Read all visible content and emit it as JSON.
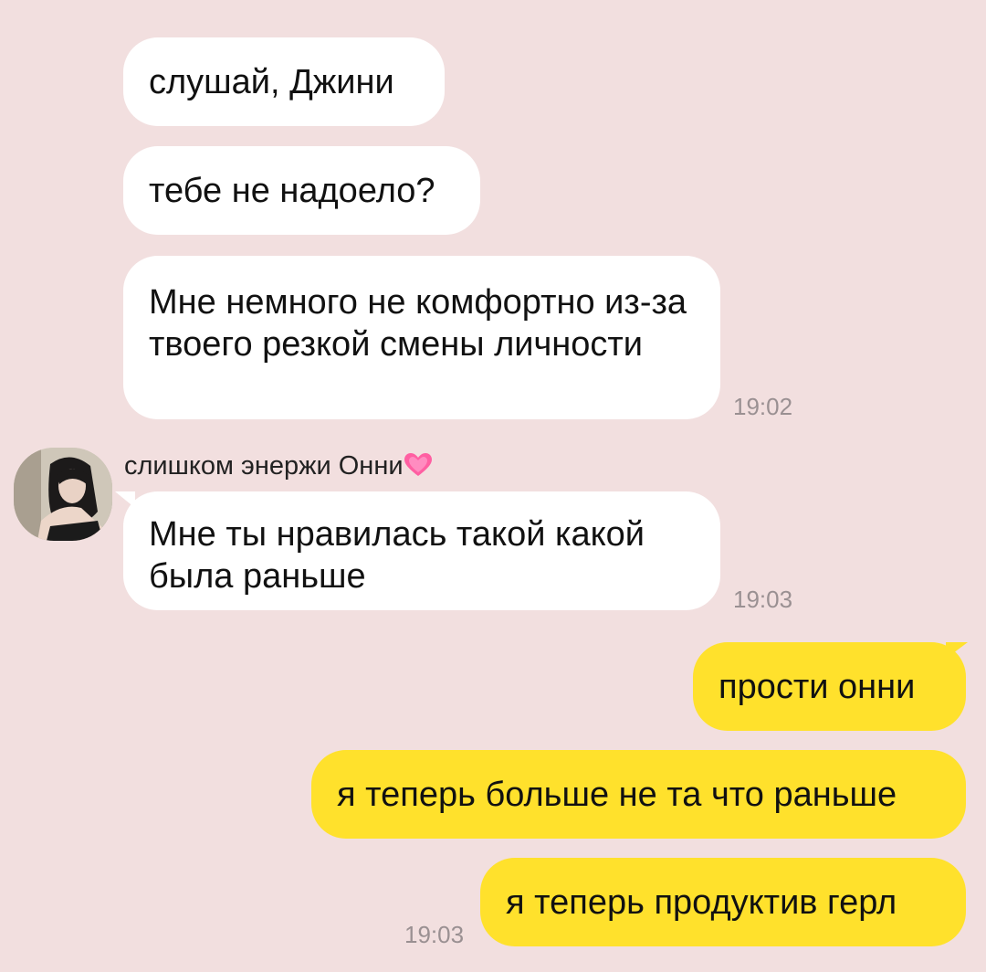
{
  "chat": {
    "incoming": [
      {
        "text": "слушай, Джини"
      },
      {
        "text": "тебе не надоело?"
      },
      {
        "text": "Мне немного не комфортно из-за твоего резкой смены личности",
        "time": "19:02"
      },
      {
        "text": "Мне ты нравилась такой какой была раньше",
        "time": "19:03"
      }
    ],
    "sender": {
      "name": "слишком энержи Онни",
      "emoji": "💓"
    },
    "outgoing": [
      {
        "text": "прости онни"
      },
      {
        "text": "я теперь больше не та что раньше"
      },
      {
        "text": "я теперь продуктив герл",
        "time": "19:03"
      }
    ]
  },
  "colors": {
    "background": "#f2dfdf",
    "incoming_bubble": "#ffffff",
    "outgoing_bubble": "#ffe12c",
    "timestamp": "#9a9092"
  }
}
